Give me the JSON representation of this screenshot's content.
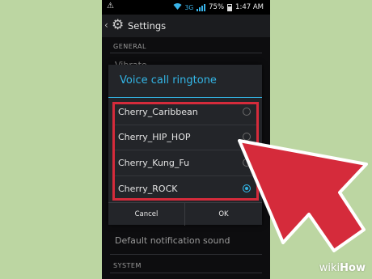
{
  "status_bar": {
    "network": "3G",
    "battery": "75%",
    "time": "1:47 AM"
  },
  "action_bar": {
    "title": "Settings"
  },
  "background_list": {
    "general_header": "GENERAL",
    "partial_item": "Vibrate",
    "item_default_notification": "Default notification sound",
    "system_header": "SYSTEM"
  },
  "dialog": {
    "title": "Voice call ringtone",
    "options": [
      {
        "label": "Cherry_Caribbean",
        "selected": false
      },
      {
        "label": "Cherry_HIP_HOP",
        "selected": false
      },
      {
        "label": "Cherry_Kung_Fu",
        "selected": false
      },
      {
        "label": "Cherry_ROCK",
        "selected": true
      }
    ],
    "cancel_label": "Cancel",
    "ok_label": "OK"
  },
  "annotation": {
    "highlight_color": "#d52b3b",
    "arrow_color": "#d52b3b"
  },
  "watermark": {
    "prefix": "wiki",
    "suffix": "How"
  }
}
